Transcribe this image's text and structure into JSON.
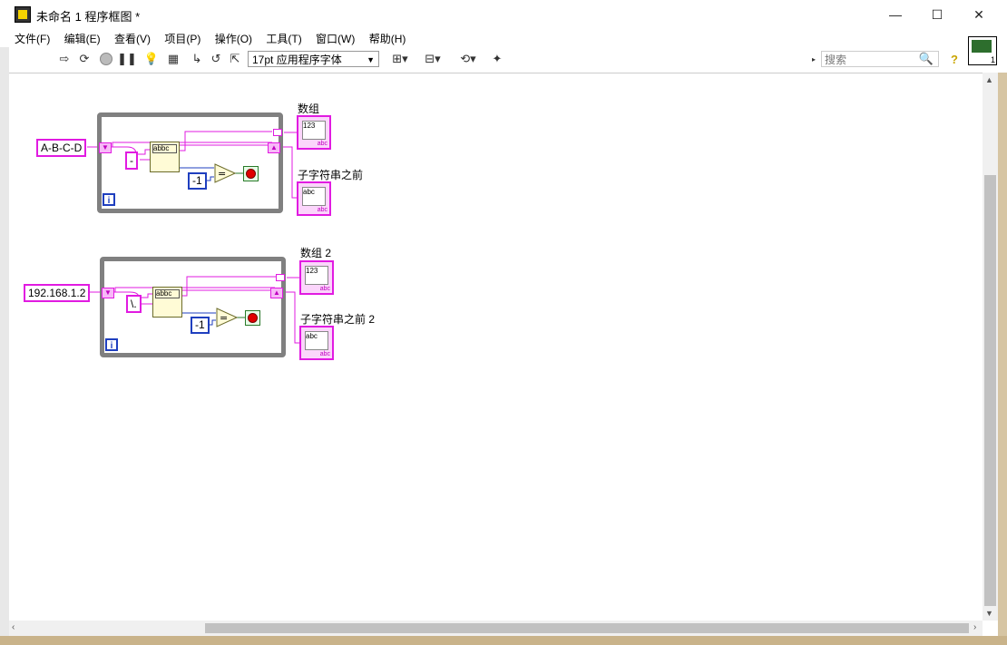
{
  "window": {
    "title": "未命名 1 程序框图 *",
    "minimize": "—",
    "maximize": "☐",
    "close": "✕"
  },
  "menu": [
    "文件(F)",
    "编辑(E)",
    "查看(V)",
    "项目(P)",
    "操作(O)",
    "工具(T)",
    "窗口(W)",
    "帮助(H)"
  ],
  "toolbar": {
    "font": "17pt 应用程序字体",
    "search_placeholder": "搜索",
    "connector_pane_number": "1"
  },
  "diagram": {
    "loop1": {
      "input_string": "A-B-C-D",
      "delimiter": "-",
      "compare_value": "-1",
      "iteration_label": "i",
      "array_label": "数组",
      "substring_label": "子字符串之前",
      "array_text": "123",
      "string_text": "abc",
      "node_text": "abbc"
    },
    "loop2": {
      "input_string": "192.168.1.2",
      "delimiter": "\\.",
      "compare_value": "-1",
      "iteration_label": "i",
      "array_label": "数组 2",
      "substring_label": "子字符串之前 2",
      "array_text": "123",
      "string_text": "abc",
      "node_text": "abbc"
    }
  },
  "colors": {
    "string_wire": "#e11be1",
    "numeric_wire": "#1f3fbf",
    "loop_border": "#808080"
  }
}
